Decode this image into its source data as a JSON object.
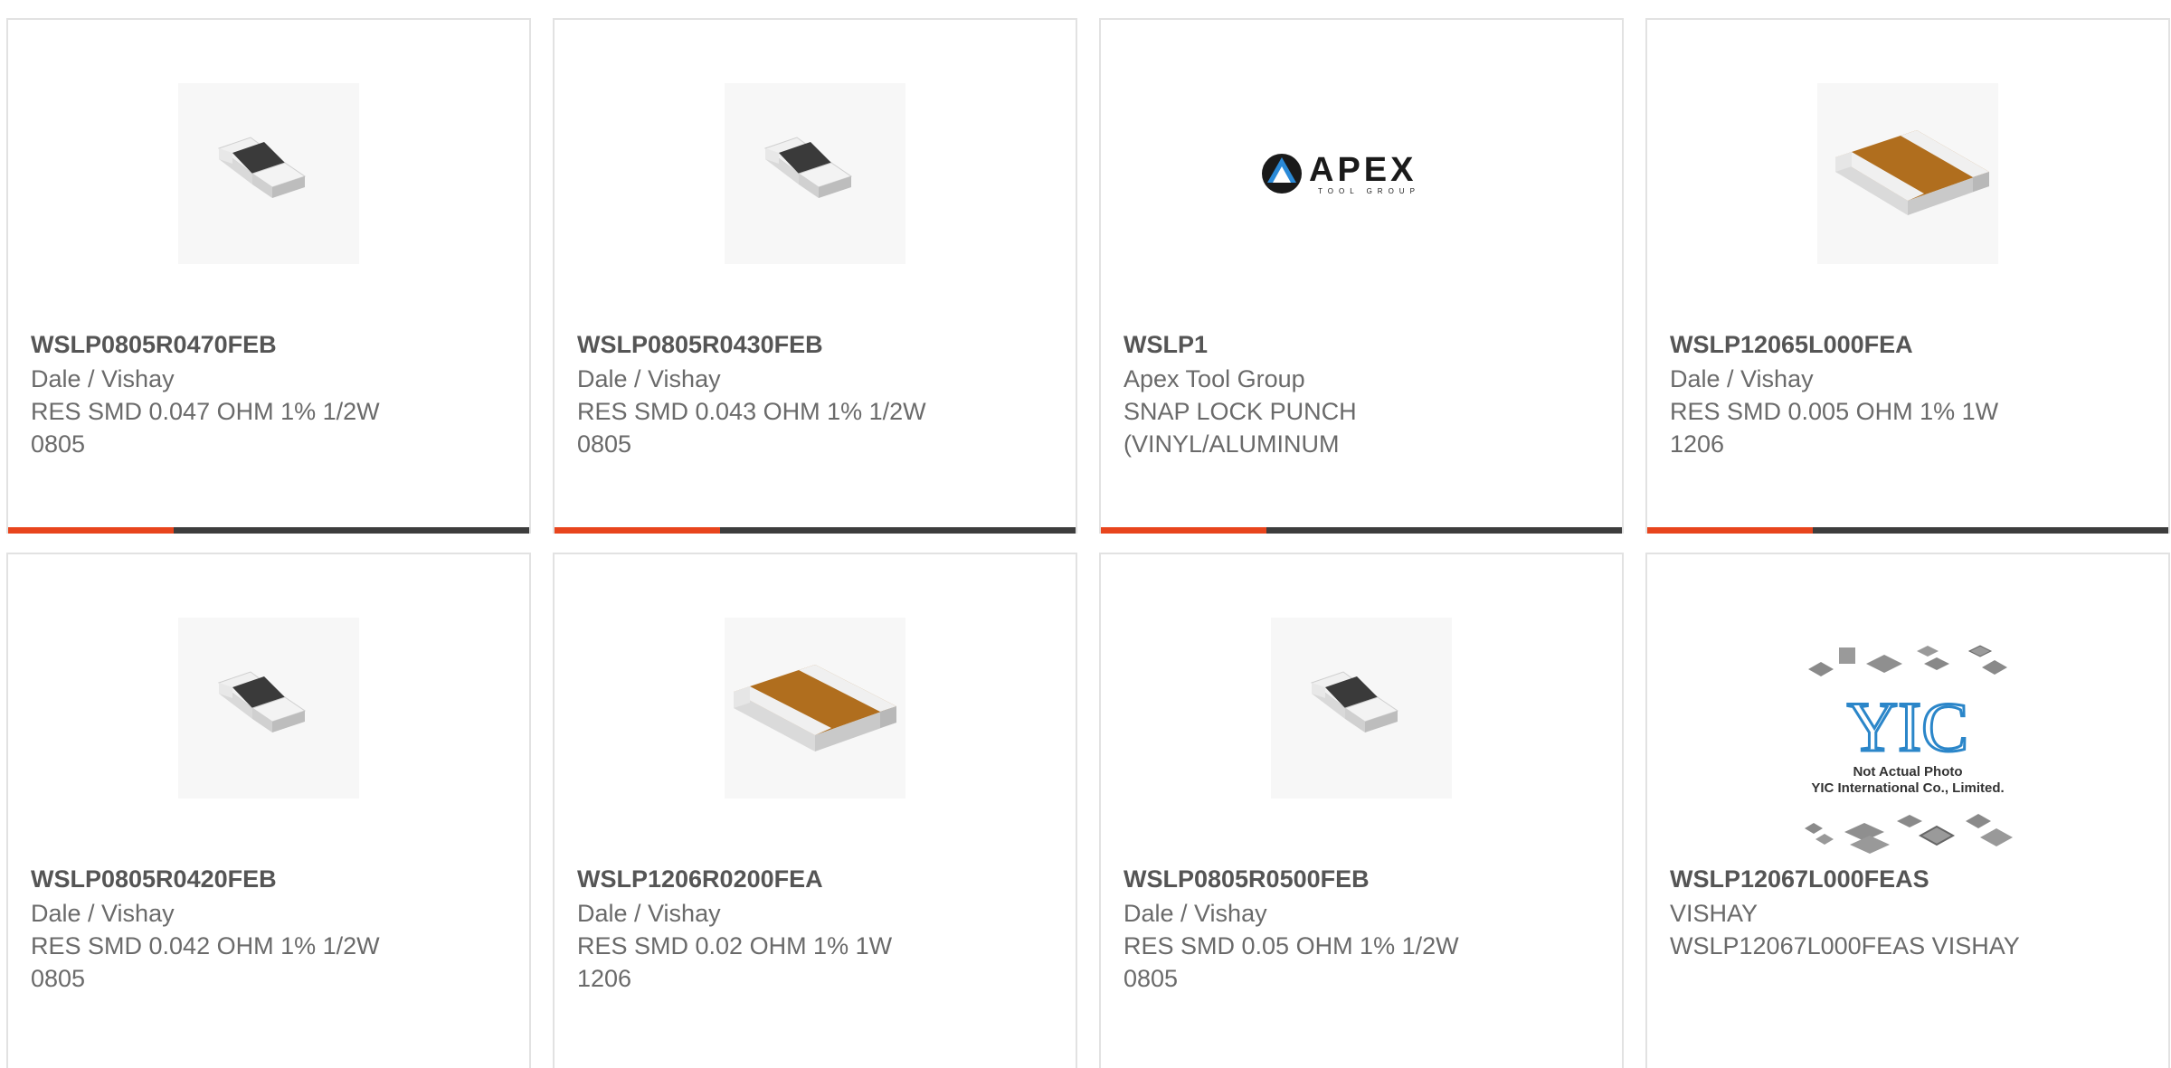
{
  "colors": {
    "accent": "#e8451d",
    "bar": "#3d3d3d",
    "border": "#e2e2e2",
    "resistor_orange": "#b06e1e",
    "resistor_dark": "#3a3a3a"
  },
  "products": [
    {
      "part_number": "WSLP0805R0470FEB",
      "manufacturer": "Dale / Vishay",
      "description": "RES SMD 0.047 OHM 1% 1/2W\n0805",
      "image": "resistor-0805-icon"
    },
    {
      "part_number": "WSLP0805R0430FEB",
      "manufacturer": "Dale / Vishay",
      "description": "RES SMD 0.043 OHM 1% 1/2W\n0805",
      "image": "resistor-0805-icon"
    },
    {
      "part_number": "WSLP1",
      "manufacturer": "Apex Tool Group",
      "description": "SNAP LOCK PUNCH\n(VINYL/ALUMINUM",
      "image": "apex-logo",
      "logo": {
        "brand": "APEX",
        "tagline": "TOOL GROUP"
      }
    },
    {
      "part_number": "WSLP12065L000FEA",
      "manufacturer": "Dale / Vishay",
      "description": "RES SMD 0.005 OHM 1% 1W\n1206",
      "image": "resistor-1206-icon"
    },
    {
      "part_number": "WSLP0805R0420FEB",
      "manufacturer": "Dale / Vishay",
      "description": "RES SMD 0.042 OHM 1% 1/2W\n0805",
      "image": "resistor-0805-icon"
    },
    {
      "part_number": "WSLP1206R0200FEA",
      "manufacturer": "Dale / Vishay",
      "description": "RES SMD 0.02 OHM 1% 1W\n1206",
      "image": "resistor-1206-icon"
    },
    {
      "part_number": "WSLP0805R0500FEB",
      "manufacturer": "Dale / Vishay",
      "description": "RES SMD 0.05 OHM 1% 1/2W\n0805",
      "image": "resistor-0805-icon"
    },
    {
      "part_number": "WSLP12067L000FEAS",
      "manufacturer": "VISHAY",
      "description": "WSLP12067L000FEAS VISHAY",
      "image": "yic-not-actual-photo",
      "logo": {
        "brand": "YIC",
        "line1": "Not Actual Photo",
        "line2": "YIC International Co., Limited."
      }
    }
  ]
}
